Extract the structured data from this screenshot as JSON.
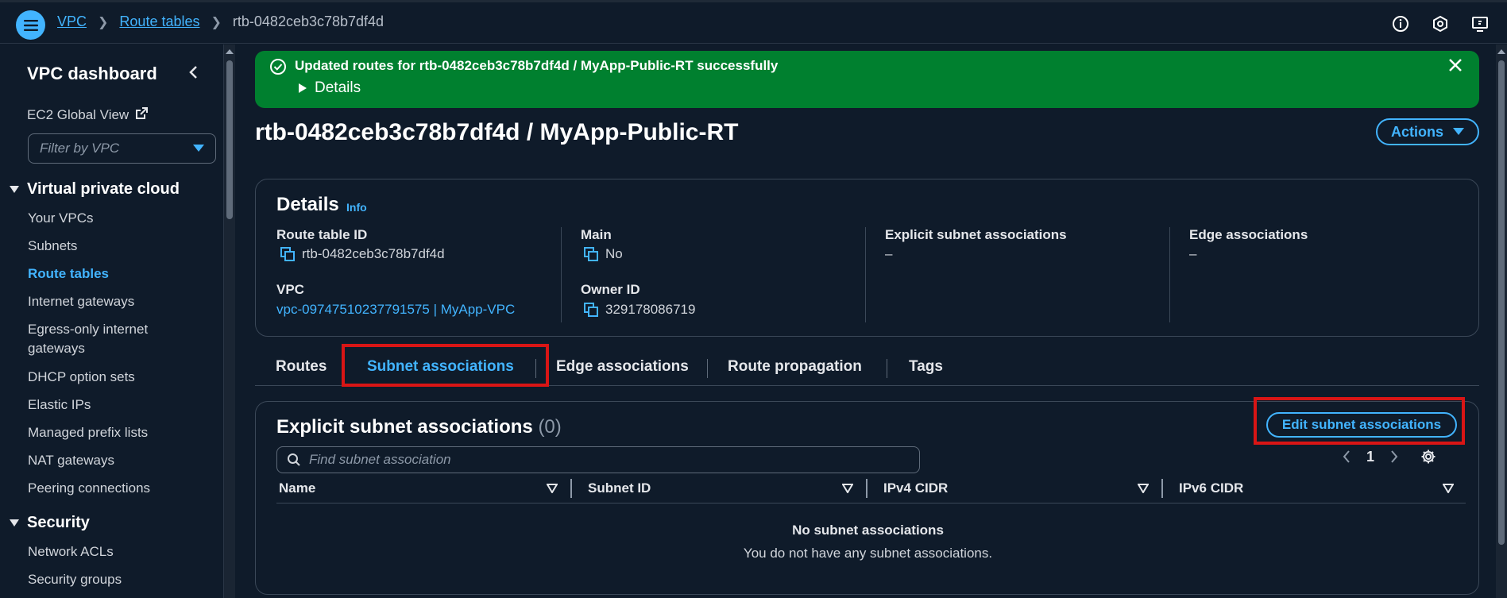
{
  "breadcrumb": {
    "root": "VPC",
    "parent": "Route tables",
    "current": "rtb-0482ceb3c78b7df4d"
  },
  "sidebar": {
    "title": "VPC dashboard",
    "ec2_global_view": "EC2 Global View",
    "filter_placeholder": "Filter by VPC",
    "sections": [
      {
        "label": "Virtual private cloud",
        "items": [
          "Your VPCs",
          "Subnets",
          "Route tables",
          "Internet gateways",
          "Egress-only internet gateways",
          "DHCP option sets",
          "Elastic IPs",
          "Managed prefix lists",
          "NAT gateways",
          "Peering connections"
        ]
      },
      {
        "label": "Security",
        "items": [
          "Network ACLs",
          "Security groups"
        ]
      }
    ],
    "active_item": "Route tables"
  },
  "flash": {
    "message": "Updated routes for rtb-0482ceb3c78b7df4d / MyApp-Public-RT successfully",
    "details": "Details",
    "color": "#00802f"
  },
  "page": {
    "title": "rtb-0482ceb3c78b7df4d / MyApp-Public-RT",
    "actions": "Actions"
  },
  "details": {
    "title": "Details",
    "info": "Info",
    "route_table_id": {
      "label": "Route table ID",
      "value": "rtb-0482ceb3c78b7df4d"
    },
    "main": {
      "label": "Main",
      "value": "No"
    },
    "explicit_subnet": {
      "label": "Explicit subnet associations",
      "value": "–"
    },
    "edge": {
      "label": "Edge associations",
      "value": "–"
    },
    "vpc": {
      "label": "VPC",
      "value": "vpc-09747510237791575 | MyApp-VPC"
    },
    "owner": {
      "label": "Owner ID",
      "value": "329178086719"
    }
  },
  "tabs": [
    "Routes",
    "Subnet associations",
    "Edge associations",
    "Route propagation",
    "Tags"
  ],
  "active_tab": "Subnet associations",
  "subnets": {
    "title": "Explicit subnet associations",
    "count": "(0)",
    "edit_button": "Edit subnet associations",
    "search_placeholder": "Find subnet association",
    "page": "1",
    "columns": [
      "Name",
      "Subnet ID",
      "IPv4 CIDR",
      "IPv6 CIDR"
    ],
    "empty_title": "No subnet associations",
    "empty_sub": "You do not have any subnet associations."
  },
  "colors": {
    "accent": "#42b4ff",
    "background": "#0f1b2a",
    "highlight": "#d91515"
  }
}
